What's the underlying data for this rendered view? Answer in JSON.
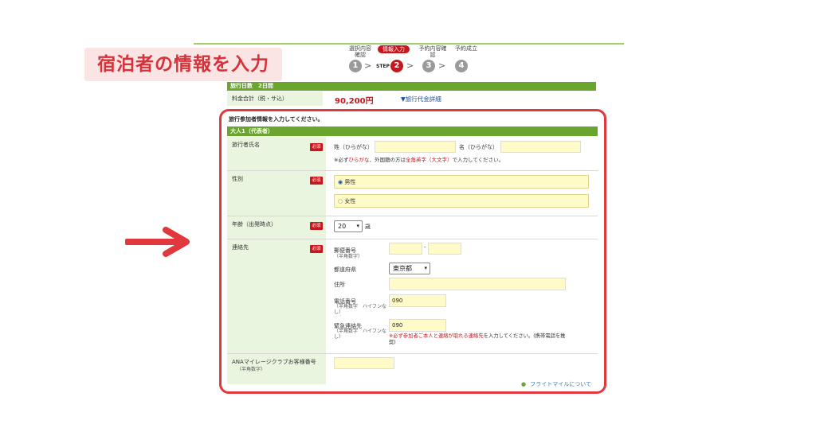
{
  "title_badge": "宿泊者の情報を入力",
  "steps": {
    "items": [
      {
        "label": "選択内容確認",
        "num": "1"
      },
      {
        "label": "情報入力",
        "num": "2"
      },
      {
        "label": "予約内容確認",
        "num": "3"
      },
      {
        "label": "予約成立",
        "num": "4"
      }
    ],
    "step_word": "STEP",
    "arrow": ">"
  },
  "summary": {
    "days": "旅行日数　2日間",
    "total_label": "料金合計（税・サ込）",
    "total_price": "90,200円",
    "detail_link": "▼旅行代金詳細"
  },
  "form": {
    "instruction": "旅行参加者情報を入力してください。",
    "section_header": "大人1（代表者）",
    "required": "必須",
    "name": {
      "label": "旅行者氏名",
      "sei_label": "姓（ひらがな）",
      "mei_label": "名（ひらがな）",
      "note_prefix": "※必ず",
      "note_red1": "ひらがな",
      "note_mid": "、外国籍の方は",
      "note_red2": "全角英字（大文字）",
      "note_suffix": "で入力してください。"
    },
    "gender": {
      "label": "性別",
      "options": [
        "男性",
        "女性"
      ],
      "selected": "男性"
    },
    "age": {
      "label": "年齢（出発時点）",
      "value": "20",
      "unit": "歳"
    },
    "contact": {
      "label": "連絡先",
      "postal_label": "郵便番号",
      "postal_sub": "（半角数字）",
      "postal_dash": "-",
      "pref_label": "都道府県",
      "pref_value": "東京都",
      "address_label": "住所",
      "phone_label": "電話番号",
      "phone_sub": "（半角数字　ハイフンなし）",
      "phone_value": "090",
      "emergency_label": "緊急連絡先",
      "emergency_sub": "（半角数字　ハイフンなし）",
      "emergency_value": "090",
      "emergency_note_red": "※必ず参加者ご本人と連絡が取れる連絡先",
      "emergency_note_rest": "を入力してください。(携帯電話を推奨)"
    },
    "ana": {
      "label": "ANAマイレージクラブお客様番号",
      "sub": "（半角数字）"
    },
    "flight_mile_link": "フライトマイルについて"
  },
  "colors": {
    "accent_red": "#e0383c",
    "green_header": "#6aa52d",
    "label_bg": "#eaf5e0",
    "input_bg": "#fffbc9"
  }
}
